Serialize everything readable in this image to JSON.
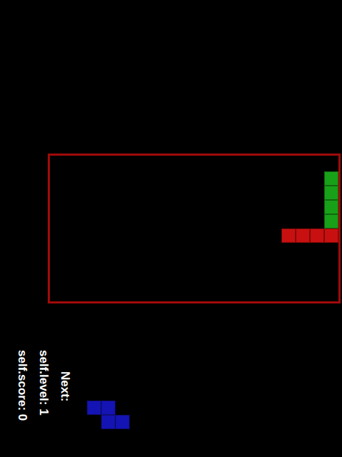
{
  "board": {
    "cols": 20,
    "rows": 10,
    "cells": [
      {
        "col": 19,
        "row": 1,
        "color": "#19a019"
      },
      {
        "col": 19,
        "row": 2,
        "color": "#19a019"
      },
      {
        "col": 19,
        "row": 3,
        "color": "#19a019"
      },
      {
        "col": 19,
        "row": 4,
        "color": "#19a019"
      },
      {
        "col": 16,
        "row": 5,
        "color": "#c81010"
      },
      {
        "col": 17,
        "row": 5,
        "color": "#c81010"
      },
      {
        "col": 18,
        "row": 5,
        "color": "#c81010"
      },
      {
        "col": 19,
        "row": 5,
        "color": "#c81010"
      }
    ]
  },
  "stats": [
    {
      "label": "self.score: 0"
    },
    {
      "label": "self.level: 1"
    }
  ],
  "next": {
    "label": "Next:",
    "cols": 3,
    "rows": 2,
    "cells": [
      {
        "col": 0,
        "row": 0,
        "color": "#1414b4"
      },
      {
        "col": 1,
        "row": 0,
        "color": "#1414b4"
      },
      {
        "col": 1,
        "row": 1,
        "color": "#1414b4"
      },
      {
        "col": 2,
        "row": 1,
        "color": "#1414b4"
      }
    ]
  }
}
